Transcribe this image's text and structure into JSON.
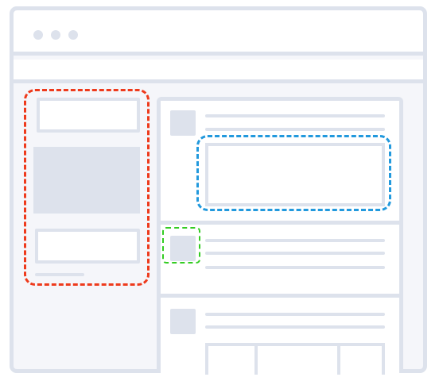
{
  "colors": {
    "frame": "#dde2ec",
    "background": "#f5f6fa",
    "panel": "#ffffff",
    "highlight_red": "#ee3a1c",
    "highlight_blue": "#2299dd",
    "highlight_green": "#33cc22"
  },
  "window": {
    "controls": [
      "window-dot-icon",
      "window-dot-icon",
      "window-dot-icon"
    ]
  },
  "highlights": [
    "sidebar",
    "post-content",
    "post-avatar"
  ]
}
